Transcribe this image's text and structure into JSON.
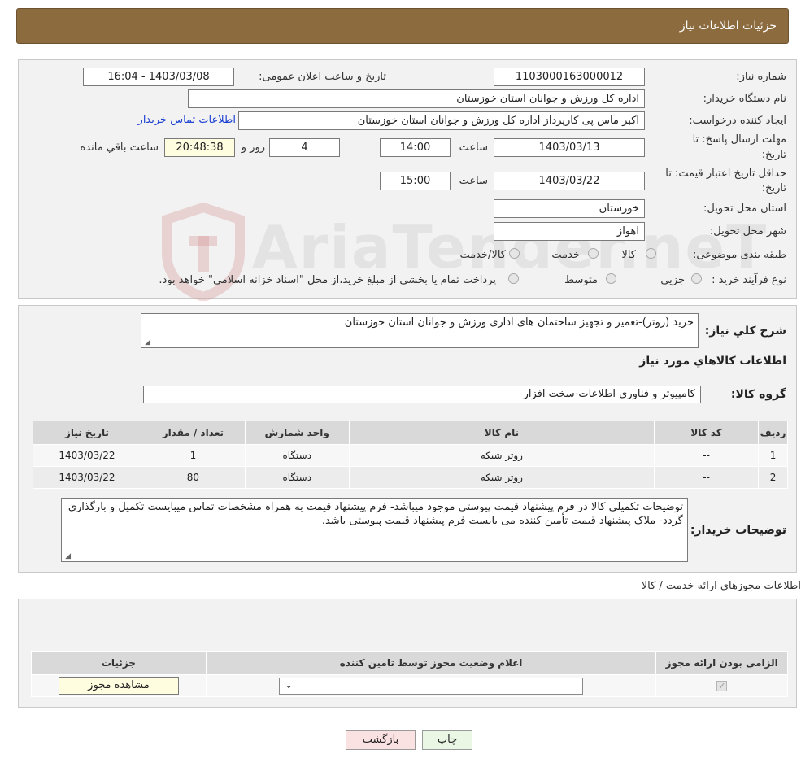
{
  "header": {
    "title": "جزئیات اطلاعات نیاز"
  },
  "watermark": {
    "text": "AriaTender.neT"
  },
  "form": {
    "need_number_label": "شماره نیاز:",
    "need_number": "1103000163000012",
    "announce_label": "تاریخ و ساعت اعلان عمومی:",
    "announce_value": "1403/03/08 - 16:04",
    "buyer_org_label": "نام دستگاه خریدار:",
    "buyer_org": "اداره کل ورزش و جوانان استان خوزستان",
    "creator_label": "ایجاد کننده درخواست:",
    "creator": "اکبر ماس پی کارپرداز اداره کل ورزش و جوانان استان خوزستان",
    "contact_link": "اطلاعات تماس خریدار",
    "deadline_label_1": "مهلت ارسال پاسخ: تا",
    "deadline_label_2": "تاریخ:",
    "deadline_date": "1403/03/13",
    "time_label": "ساعت",
    "deadline_time": "14:00",
    "days_value": "4",
    "days_label": "روز و",
    "remaining_time": "20:48:38",
    "remaining_label": "ساعت باقي مانده",
    "validity_label_1": "حداقل تاریخ اعتبار قیمت: تا",
    "validity_label_2": "تاریخ:",
    "validity_date": "1403/03/22",
    "validity_time": "15:00",
    "province_label": "استان محل تحویل:",
    "province": "خوزستان",
    "city_label": "شهر محل تحویل:",
    "city": "اهواز",
    "category_label": "طبقه بندی موضوعی:",
    "category_options": [
      "کالا",
      "خدمت",
      "کالا/خدمت"
    ],
    "process_label": "نوع فرآیند خرید :",
    "process_options": [
      "جزیي",
      "متوسط"
    ],
    "process_note": "پرداخت تمام یا بخشی از مبلغ خرید،از محل \"اسناد خزانه اسلامی\" خواهد بود."
  },
  "description": {
    "label": "شرح کلي نياز:",
    "text": "خرید (روتر)-تعمیر و تجهیز ساختمان های اداری ورزش و جوانان استان خوزستان"
  },
  "goods": {
    "section_title": "اطلاعات کالاهاي مورد نياز",
    "group_label": "گروه کالا:",
    "group_value": "کامپیوتر و فناوری اطلاعات-سخت افزار",
    "columns": [
      "رديف",
      "کد کالا",
      "نام کالا",
      "واحد شمارش",
      "تعداد / مقدار",
      "تاریخ نیاز"
    ],
    "rows": [
      [
        "1",
        "--",
        "روتر شبکه",
        "دستگاه",
        "1",
        "1403/03/22"
      ],
      [
        "2",
        "--",
        "روتر شبکه",
        "دستگاه",
        "80",
        "1403/03/22"
      ]
    ]
  },
  "buyer_notes": {
    "label": "توضیحات خریدار:",
    "text": "توضیحات تکمیلی کالا در فرم پیشنهاد قیمت پیوستی موجود میباشد- فرم پیشنهاد قیمت به همراه مشخصات تماس میبایست تکمیل و بارگذاری گردد- ملاک پیشنهاد قیمت تأمین کننده می بایست فرم پیشنهاد قیمت پیوستی باشد."
  },
  "permits": {
    "section_title": "اطلاعات مجوزهای ارائه خدمت / کالا",
    "columns": [
      "الزامی بودن ارائه مجوز",
      "اعلام وضعیت مجوز توسط تامین کننده",
      "جزئیات"
    ],
    "select_value": "--",
    "view_button": "مشاهده مجوز"
  },
  "buttons": {
    "print": "چاپ",
    "back": "بازگشت"
  }
}
